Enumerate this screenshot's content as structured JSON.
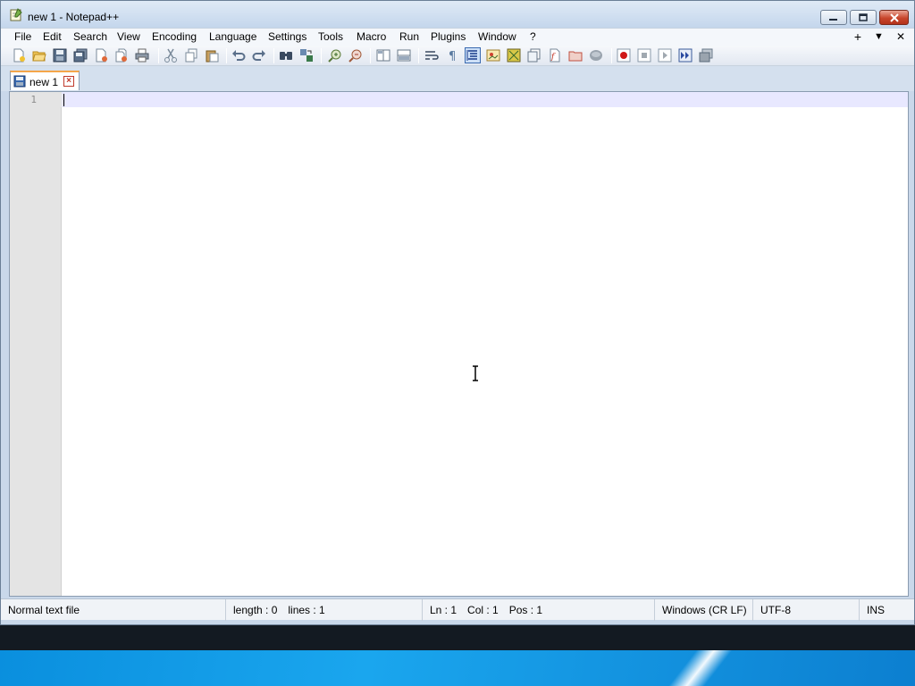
{
  "window": {
    "title": "new 1 - Notepad++",
    "app_icon": "notepad-icon",
    "controls": [
      "minimize-icon",
      "maximize-icon",
      "close-icon"
    ]
  },
  "menubar": {
    "items": [
      "File",
      "Edit",
      "Search",
      "View",
      "Encoding",
      "Language",
      "Settings",
      "Tools",
      "Macro",
      "Run",
      "Plugins",
      "Window",
      "?"
    ],
    "right": {
      "add": "+",
      "dropdown": "▼",
      "close": "✕"
    }
  },
  "toolbar": {
    "buttons": [
      "new-file-icon",
      "open-file-icon",
      "save-icon",
      "save-all-icon",
      "close-icon",
      "close-all-icon",
      "print-icon",
      "cut-icon",
      "copy-icon",
      "paste-icon",
      "undo-icon",
      "redo-icon",
      "find-icon",
      "replace-icon",
      "zoom-in-icon",
      "zoom-out-icon",
      "sync-vertical-icon",
      "sync-horizontal-icon",
      "word-wrap-icon",
      "show-all-chars-icon",
      "indent-guide-icon",
      "user-language-icon",
      "document-map-icon",
      "function-list-icon",
      "folder-workspace-icon",
      "monitoring-icon",
      "record-macro-icon",
      "stop-record-icon",
      "playback-icon",
      "run-macro-multiple-icon",
      "save-macro-icon"
    ]
  },
  "tabs": [
    {
      "label": "new 1",
      "icon": "save-icon",
      "close": "close-icon"
    }
  ],
  "editor": {
    "line_numbers": [
      "1"
    ],
    "content": ""
  },
  "statusbar": {
    "file_type": "Normal text file",
    "length": "length : 0",
    "lines": "lines : 1",
    "ln": "Ln : 1",
    "col": "Col : 1",
    "pos": "Pos : 1",
    "eol": "Windows (CR LF)",
    "encoding": "UTF-8",
    "mode": "INS"
  },
  "colors": {
    "current_line": "#e8e8ff",
    "tab_accent": "#f5a64a",
    "close_button": "#c8462c"
  }
}
